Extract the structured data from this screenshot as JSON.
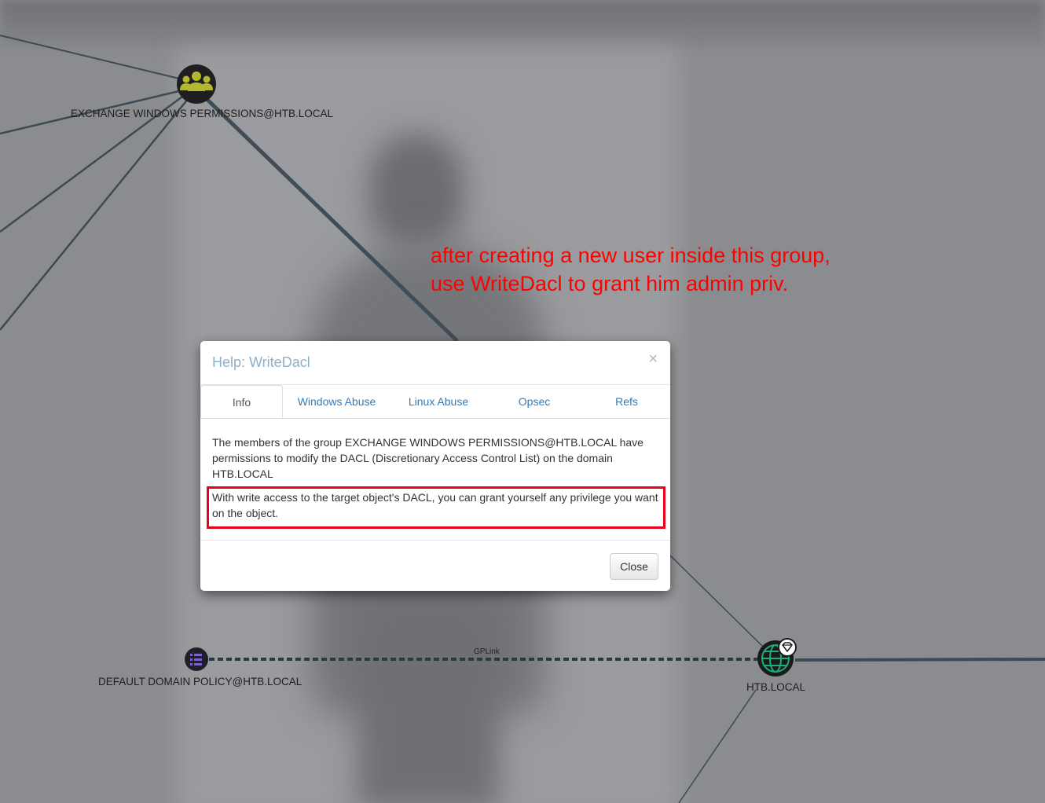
{
  "graph": {
    "nodes": {
      "group": {
        "label": "EXCHANGE WINDOWS PERMISSIONS@HTB.LOCAL",
        "icon": "group-icon",
        "color": "#b4b830"
      },
      "gpo": {
        "label": "DEFAULT DOMAIN POLICY@HTB.LOCAL",
        "icon": "gpo-list-icon",
        "color": "#6d54b4"
      },
      "domain": {
        "label": "HTB.LOCAL",
        "icon": "domain-globe-icon",
        "color": "#17b07a"
      }
    },
    "edges": {
      "gplink_label": "GPLink"
    }
  },
  "annotation": {
    "line1": "after creating a new user inside this  group,",
    "line2": "use WriteDacl to grant him admin priv.",
    "color": "#ff0000"
  },
  "modal": {
    "title": "Help: WriteDacl",
    "close_symbol": "×",
    "tabs": [
      {
        "label": "Info",
        "active": true
      },
      {
        "label": "Windows Abuse",
        "active": false
      },
      {
        "label": "Linux Abuse",
        "active": false
      },
      {
        "label": "Opsec",
        "active": false
      },
      {
        "label": "Refs",
        "active": false
      }
    ],
    "body": {
      "paragraph1": "The members of the group EXCHANGE WINDOWS PERMISSIONS@HTB.LOCAL have permissions to modify the DACL (Discretionary Access Control List) on the domain HTB.LOCAL",
      "paragraph2": "With write access to the target object's DACL, you can grant yourself any privilege you want on the object."
    },
    "footer": {
      "close_button": "Close"
    }
  }
}
